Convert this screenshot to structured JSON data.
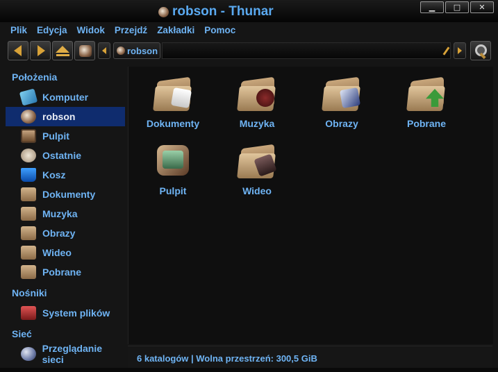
{
  "window": {
    "title": "robson - Thunar",
    "controls": [
      "▁",
      "□",
      "✕"
    ]
  },
  "menubar": [
    "Plik",
    "Edycja",
    "Widok",
    "Przejdź",
    "Zakładki",
    "Pomoc"
  ],
  "toolbar": {
    "breadcrumb": "robson",
    "buttons": [
      "back-icon",
      "forward-icon",
      "up-icon",
      "home-icon"
    ],
    "zoom_icon": "magnifier-icon"
  },
  "sidebar": {
    "sections": [
      {
        "title": "Położenia",
        "items": [
          {
            "label": "Komputer",
            "icon": "computer-icon"
          },
          {
            "label": "robson",
            "icon": "home-icon",
            "selected": true
          },
          {
            "label": "Pulpit",
            "icon": "desktop-icon"
          },
          {
            "label": "Ostatnie",
            "icon": "recent-icon"
          },
          {
            "label": "Kosz",
            "icon": "trash-icon"
          },
          {
            "label": "Dokumenty",
            "icon": "folder-documents-icon"
          },
          {
            "label": "Muzyka",
            "icon": "folder-music-icon"
          },
          {
            "label": "Obrazy",
            "icon": "folder-pictures-icon"
          },
          {
            "label": "Wideo",
            "icon": "folder-videos-icon"
          },
          {
            "label": "Pobrane",
            "icon": "folder-downloads-icon"
          }
        ]
      },
      {
        "title": "Nośniki",
        "items": [
          {
            "label": "System plików",
            "icon": "drive-icon"
          }
        ]
      },
      {
        "title": "Sieć",
        "items": [
          {
            "label": "Przeglądanie sieci",
            "icon": "network-icon"
          }
        ]
      }
    ]
  },
  "main": {
    "items": [
      {
        "label": "Dokumenty",
        "icon": "folder-documents-icon"
      },
      {
        "label": "Muzyka",
        "icon": "folder-music-icon"
      },
      {
        "label": "Obrazy",
        "icon": "folder-pictures-icon"
      },
      {
        "label": "Pobrane",
        "icon": "folder-downloads-icon"
      },
      {
        "label": "Pulpit",
        "icon": "desktop-icon"
      },
      {
        "label": "Wideo",
        "icon": "folder-videos-icon"
      }
    ]
  },
  "status": {
    "text": "6 katalogów  |  Wolna przestrzeń: 300,5 GiB"
  },
  "colors": {
    "accent": "#6fb4f4",
    "selection": "#0f2c6e",
    "background": "#151515"
  }
}
